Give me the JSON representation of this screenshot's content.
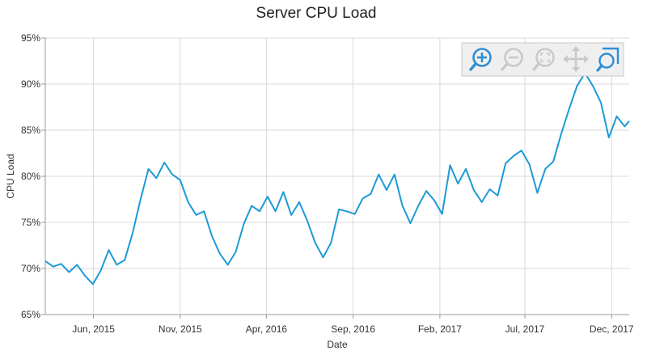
{
  "chart_data": {
    "type": "line",
    "title": "Server CPU Load",
    "xlabel": "Date",
    "ylabel": "CPU Load",
    "ylim": [
      65,
      95
    ],
    "y_ticks": [
      "65%",
      "70%",
      "75%",
      "80%",
      "85%",
      "90%",
      "95%"
    ],
    "xlim": [
      "2015-03-08",
      "2018-01-01"
    ],
    "x_ticks": [
      {
        "date": "2015-06-01",
        "label": "Jun, 2015"
      },
      {
        "date": "2015-11-01",
        "label": "Nov, 2015"
      },
      {
        "date": "2016-04-01",
        "label": "Apr, 2016"
      },
      {
        "date": "2016-09-01",
        "label": "Sep, 2016"
      },
      {
        "date": "2017-02-01",
        "label": "Feb, 2017"
      },
      {
        "date": "2017-07-01",
        "label": "Jul, 2017"
      },
      {
        "date": "2017-12-01",
        "label": "Dec, 2017"
      }
    ],
    "grid": true,
    "legend": false,
    "series": [
      {
        "color": "#1e9ad6",
        "points": [
          [
            "2015-03-08",
            70.8
          ],
          [
            "2015-03-22",
            70.2
          ],
          [
            "2015-04-05",
            70.5
          ],
          [
            "2015-04-19",
            69.6
          ],
          [
            "2015-05-03",
            70.4
          ],
          [
            "2015-05-17",
            69.2
          ],
          [
            "2015-05-31",
            68.3
          ],
          [
            "2015-06-14",
            69.8
          ],
          [
            "2015-06-28",
            72.0
          ],
          [
            "2015-07-12",
            70.4
          ],
          [
            "2015-07-26",
            70.9
          ],
          [
            "2015-08-09",
            73.8
          ],
          [
            "2015-08-23",
            77.5
          ],
          [
            "2015-09-06",
            80.8
          ],
          [
            "2015-09-20",
            79.8
          ],
          [
            "2015-10-04",
            81.5
          ],
          [
            "2015-10-18",
            80.2
          ],
          [
            "2015-11-01",
            79.6
          ],
          [
            "2015-11-15",
            77.2
          ],
          [
            "2015-11-29",
            75.8
          ],
          [
            "2015-12-13",
            76.2
          ],
          [
            "2015-12-27",
            73.5
          ],
          [
            "2016-01-10",
            71.6
          ],
          [
            "2016-01-24",
            70.4
          ],
          [
            "2016-02-07",
            71.8
          ],
          [
            "2016-02-21",
            74.8
          ],
          [
            "2016-03-06",
            76.8
          ],
          [
            "2016-03-20",
            76.2
          ],
          [
            "2016-04-03",
            77.8
          ],
          [
            "2016-04-17",
            76.2
          ],
          [
            "2016-05-01",
            78.3
          ],
          [
            "2016-05-15",
            75.8
          ],
          [
            "2016-05-29",
            77.2
          ],
          [
            "2016-06-12",
            75.2
          ],
          [
            "2016-06-26",
            72.8
          ],
          [
            "2016-07-10",
            71.2
          ],
          [
            "2016-07-24",
            72.8
          ],
          [
            "2016-08-07",
            76.4
          ],
          [
            "2016-08-21",
            76.2
          ],
          [
            "2016-09-04",
            75.9
          ],
          [
            "2016-09-18",
            77.6
          ],
          [
            "2016-10-02",
            78.1
          ],
          [
            "2016-10-16",
            80.2
          ],
          [
            "2016-10-30",
            78.5
          ],
          [
            "2016-11-13",
            80.2
          ],
          [
            "2016-11-27",
            76.8
          ],
          [
            "2016-12-11",
            74.9
          ],
          [
            "2016-12-25",
            76.8
          ],
          [
            "2017-01-08",
            78.4
          ],
          [
            "2017-01-22",
            77.4
          ],
          [
            "2017-02-05",
            75.9
          ],
          [
            "2017-02-19",
            81.2
          ],
          [
            "2017-03-05",
            79.2
          ],
          [
            "2017-03-19",
            80.8
          ],
          [
            "2017-04-02",
            78.5
          ],
          [
            "2017-04-16",
            77.2
          ],
          [
            "2017-04-30",
            78.6
          ],
          [
            "2017-05-14",
            77.9
          ],
          [
            "2017-05-28",
            81.4
          ],
          [
            "2017-06-11",
            82.2
          ],
          [
            "2017-06-25",
            82.8
          ],
          [
            "2017-07-09",
            81.3
          ],
          [
            "2017-07-23",
            78.2
          ],
          [
            "2017-08-06",
            80.8
          ],
          [
            "2017-08-20",
            81.6
          ],
          [
            "2017-09-03",
            84.6
          ],
          [
            "2017-09-17",
            87.3
          ],
          [
            "2017-10-01",
            89.8
          ],
          [
            "2017-10-15",
            91.2
          ],
          [
            "2017-10-29",
            89.8
          ],
          [
            "2017-11-12",
            88.0
          ],
          [
            "2017-11-26",
            84.2
          ],
          [
            "2017-12-10",
            86.5
          ],
          [
            "2017-12-24",
            85.4
          ],
          [
            "2018-01-01",
            86.0
          ]
        ]
      }
    ]
  },
  "toolbar": {
    "zoom_in_icon": "zoom-in-icon",
    "zoom_out_icon": "zoom-out-icon",
    "reset_zoom_icon": "reset-zoom-icon",
    "pan_icon": "pan-icon",
    "selection_zoom_icon": "selection-zoom-icon"
  }
}
